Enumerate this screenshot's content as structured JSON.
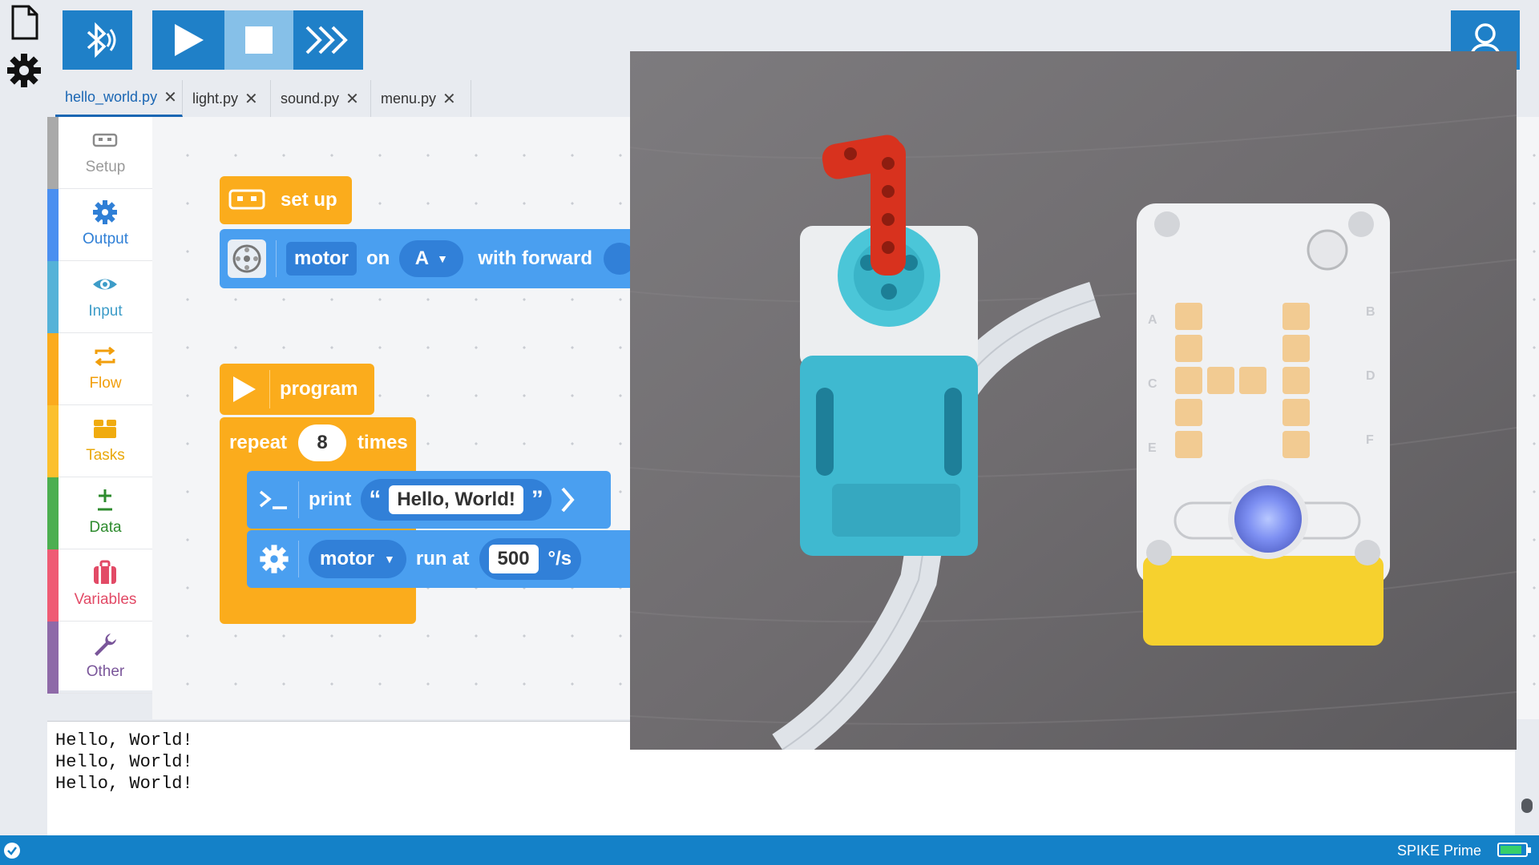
{
  "toolbar": {
    "bluetooth_icon": "bluetooth-icon",
    "run_icon": "play-icon",
    "stop_icon": "stop-icon",
    "repl_icon": "fast-forward-icon",
    "user_icon": "user-icon"
  },
  "tabs": [
    {
      "label": "hello_world.py",
      "active": true
    },
    {
      "label": "light.py"
    },
    {
      "label": "sound.py"
    },
    {
      "label": "menu.py"
    }
  ],
  "categories": [
    {
      "label": "Setup",
      "color": "#a9a9a9",
      "text_color": "#9a9a9a",
      "icon": "hub-icon"
    },
    {
      "label": "Output",
      "color": "#4a8ff0",
      "text_color": "#2f7fd6",
      "icon": "gear-icon"
    },
    {
      "label": "Input",
      "color": "#55b2d8",
      "text_color": "#3d9cc8",
      "icon": "eye-icon"
    },
    {
      "label": "Flow",
      "color": "#fbab1d",
      "text_color": "#f19e0b",
      "icon": "loop-icon"
    },
    {
      "label": "Tasks",
      "color": "#fbc02d",
      "text_color": "#e9a80b",
      "icon": "brick-icon"
    },
    {
      "label": "Data",
      "color": "#4caf50",
      "text_color": "#2e8b2e",
      "icon": "plus-minus-icon"
    },
    {
      "label": "Variables",
      "color": "#ef5b74",
      "text_color": "#e24a66",
      "icon": "suitcase-icon"
    },
    {
      "label": "Other",
      "color": "#8e6aa8",
      "text_color": "#7a569a",
      "icon": "wrench-icon"
    }
  ],
  "blocks": {
    "setup_label": "set up",
    "motor_label": "motor",
    "on_label": "on",
    "port_value": "A",
    "with_forward_label": "with forward",
    "program_label": "program",
    "repeat_label": "repeat",
    "repeat_count": "8",
    "times_label": "times",
    "print_label": "print",
    "open_quote": "“",
    "print_text": "Hello, World!",
    "close_quote": "”",
    "run_motor_label": "motor",
    "run_at_label": "run at",
    "speed_value": "500",
    "speed_unit": "°/s"
  },
  "console": {
    "lines": [
      "Hello, World!",
      "Hello, World!",
      "Hello, World!"
    ]
  },
  "status": {
    "hub_name": "SPIKE Prime",
    "battery_level": 0.85,
    "connected_icon": "check-circle-icon"
  },
  "photo": {
    "hub_display_letter": "H",
    "port_labels": [
      "A",
      "B",
      "C",
      "D",
      "E",
      "F"
    ]
  }
}
